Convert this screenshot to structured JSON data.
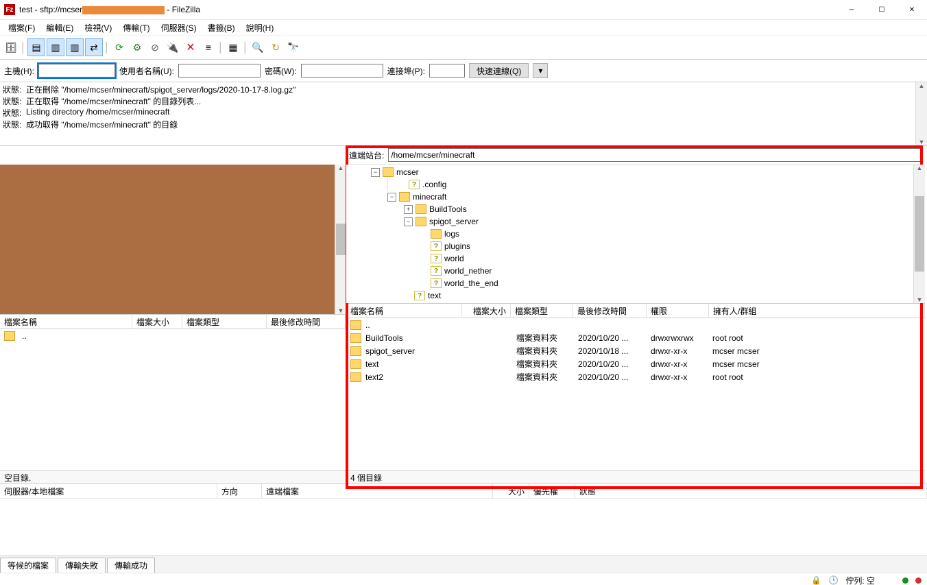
{
  "title": {
    "prefix": "test - sftp://mcser",
    "suffix": "- FileZilla"
  },
  "window_buttons": {
    "min": "─",
    "max": "☐",
    "close": "✕"
  },
  "menu": {
    "file": "檔案(F)",
    "edit": "編輯(E)",
    "view": "檢視(V)",
    "transfer": "傳輸(T)",
    "server": "伺服器(S)",
    "bookmarks": "書籤(B)",
    "help": "說明(H)"
  },
  "toolbar": {
    "sitemgr": "🗄",
    "toggle1": "▤",
    "toggle2": "▥",
    "toggle3": "▥",
    "toggle4": "⇄",
    "refresh": "⟳",
    "settings": "⚙",
    "cancel": "⊘",
    "disconnect": "🔌",
    "reconnect": "🗙",
    "filter": "≡",
    "compare": "▦",
    "search": "🔍",
    "process": "↻",
    "binoculars": "🔭"
  },
  "quickconnect": {
    "host_label": "主機(H):",
    "user_label": "使用者名稱(U):",
    "pass_label": "密碼(W):",
    "port_label": "連接埠(P):",
    "button": "快速連線(Q)",
    "expand": "▾",
    "host": "",
    "user": "",
    "pass": "",
    "port": ""
  },
  "log": [
    {
      "label": "狀態:",
      "text": "正在刪除 \"/home/mcser/minecraft/spigot_server/logs/2020-10-17-8.log.gz\""
    },
    {
      "label": "狀態:",
      "text": "正在取得 \"/home/mcser/minecraft\" 的目錄列表..."
    },
    {
      "label": "狀態:",
      "text": "Listing directory /home/mcser/minecraft"
    },
    {
      "label": "狀態:",
      "text": "成功取得 \"/home/mcser/minecraft\" 的目錄"
    }
  ],
  "remote": {
    "label": "遠端站台:",
    "path": "/home/mcser/minecraft",
    "tree": {
      "mcser": "mcser",
      "config": ".config",
      "minecraft": "minecraft",
      "buildtools": "BuildTools",
      "spigot": "spigot_server",
      "logs": "logs",
      "plugins": "plugins",
      "world": "world",
      "nether": "world_nether",
      "end": "world_the_end",
      "text": "text"
    },
    "headers": {
      "name": "檔案名稱",
      "size": "檔案大小",
      "type": "檔案類型",
      "mtime": "最後修改時間",
      "perm": "權限",
      "owner": "擁有人/群組"
    },
    "rows": [
      {
        "name": "..",
        "size": "",
        "type": "",
        "mtime": "",
        "perm": "",
        "owner": ""
      },
      {
        "name": "BuildTools",
        "size": "",
        "type": "檔案資料夾",
        "mtime": "2020/10/20 ...",
        "perm": "drwxrwxrwx",
        "owner": "root root"
      },
      {
        "name": "spigot_server",
        "size": "",
        "type": "檔案資料夾",
        "mtime": "2020/10/18 ...",
        "perm": "drwxr-xr-x",
        "owner": "mcser mcser"
      },
      {
        "name": "text",
        "size": "",
        "type": "檔案資料夾",
        "mtime": "2020/10/20 ...",
        "perm": "drwxr-xr-x",
        "owner": "mcser mcser"
      },
      {
        "name": "text2",
        "size": "",
        "type": "檔案資料夾",
        "mtime": "2020/10/20 ...",
        "perm": "drwxr-xr-x",
        "owner": "root root"
      }
    ],
    "status": "4 個目錄"
  },
  "local": {
    "headers": {
      "name": "檔案名稱",
      "size": "檔案大小",
      "type": "檔案類型",
      "mtime": "最後修改時間"
    },
    "updir": "..",
    "status": "空目錄."
  },
  "queue": {
    "headers": {
      "srv": "伺服器/本地檔案",
      "dir": "方向",
      "remote": "遠端檔案",
      "size": "大小",
      "priority": "優先權",
      "status": "狀態"
    }
  },
  "tabs": {
    "queued": "等候的檔案",
    "failed": "傳輸失敗",
    "success": "傳輸成功"
  },
  "footer": {
    "lock": "🔒",
    "queue": "佇列: 空"
  }
}
